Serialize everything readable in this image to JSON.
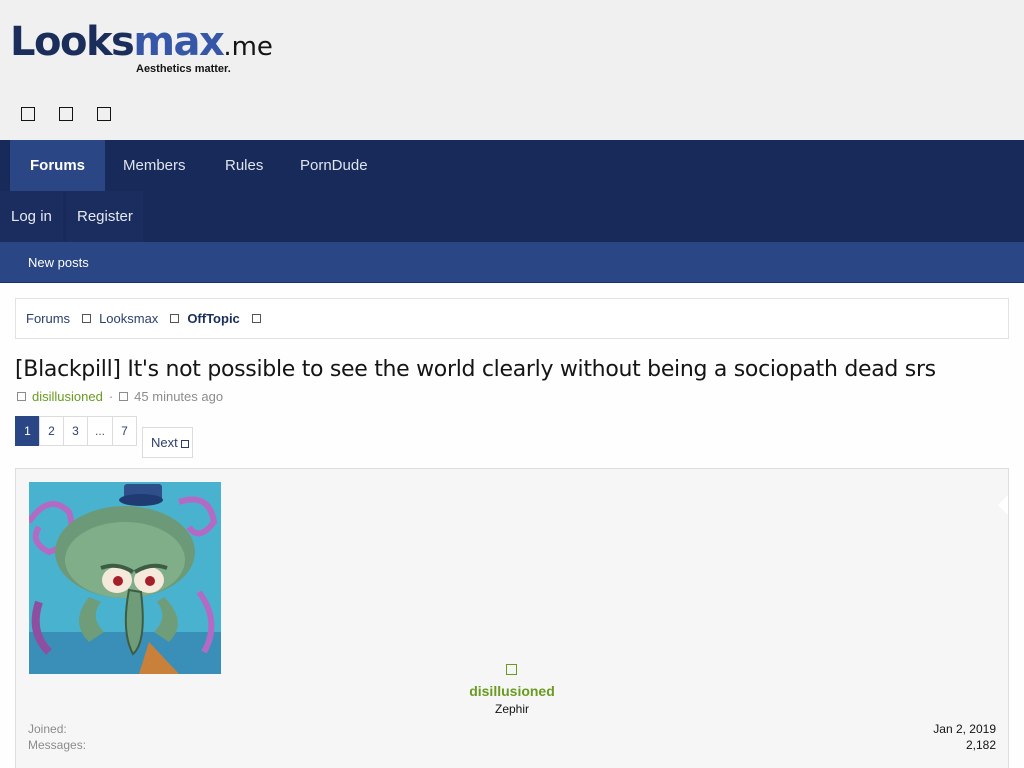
{
  "site": {
    "logo_left": "Looks",
    "logo_right": "max",
    "logo_tld": ".me",
    "tagline": "Aesthetics matter.",
    "header_icons": [
      "square-icon",
      "square-icon",
      "square-icon"
    ]
  },
  "nav": {
    "tabs": [
      {
        "label": "Forums",
        "active": true
      },
      {
        "label": "Members",
        "active": false
      },
      {
        "label": "Rules",
        "active": false
      },
      {
        "label": "PornDude",
        "active": false
      }
    ],
    "account": {
      "login": "Log in",
      "register": "Register"
    },
    "subnav": {
      "new_posts": "New posts"
    }
  },
  "breadcrumb": {
    "items": [
      "Forums",
      "Looksmax",
      "OffTopic"
    ]
  },
  "thread": {
    "title": "[Blackpill] It's not possible to see the world clearly without being a sociopath dead srs",
    "author": "disillusioned",
    "time": "45 minutes ago"
  },
  "pagination": {
    "pages": [
      "1",
      "2",
      "3",
      "...",
      "7"
    ],
    "current": "1",
    "next_label": "Next"
  },
  "post": {
    "username": "disillusioned",
    "user_title": "Zephir",
    "joined_label": "Joined:",
    "joined_value": "Jan 2, 2019",
    "messages_label": "Messages:",
    "messages_value": "2,182"
  },
  "colors": {
    "nav_bg": "#182a59",
    "nav_active": "#2a4685",
    "username_green": "#6a9a1f",
    "header_bg": "#f0f0f0"
  }
}
